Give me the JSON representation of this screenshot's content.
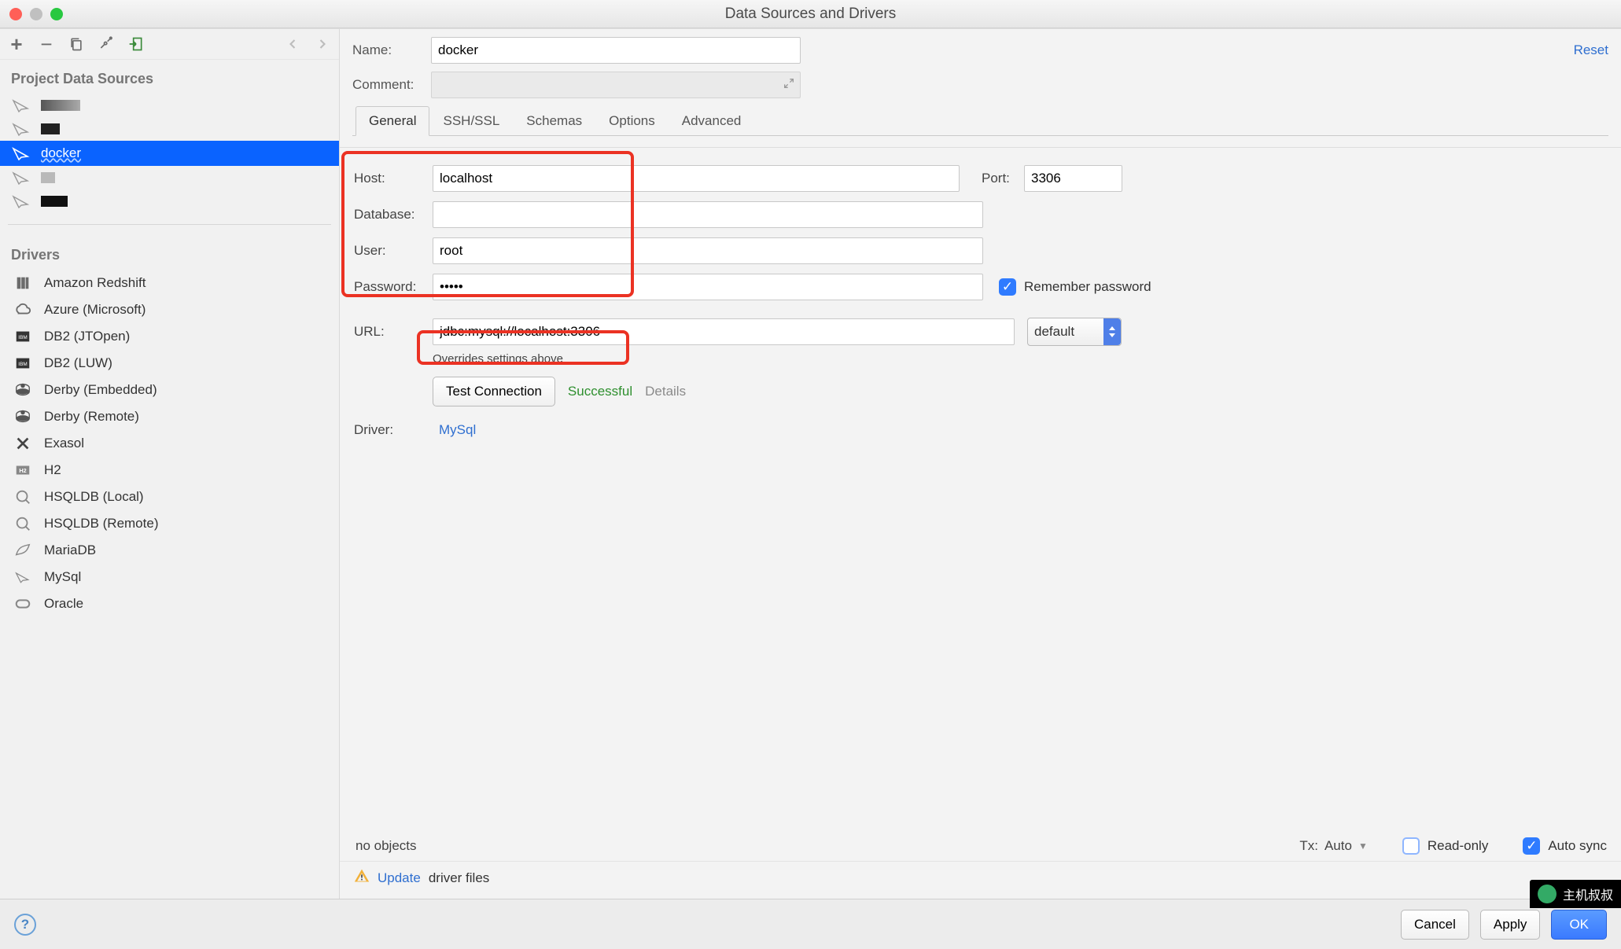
{
  "window": {
    "title": "Data Sources and Drivers"
  },
  "reset_label": "Reset",
  "toolbar": {
    "plus": "+",
    "minus": "−"
  },
  "sidebar": {
    "ds_title": "Project Data Sources",
    "items": [
      {
        "label": ""
      },
      {
        "label": ""
      },
      {
        "label": "docker",
        "selected": true
      },
      {
        "label": ""
      },
      {
        "label": ""
      }
    ],
    "drivers_title": "Drivers",
    "drivers": [
      "Amazon Redshift",
      "Azure (Microsoft)",
      "DB2 (JTOpen)",
      "DB2 (LUW)",
      "Derby (Embedded)",
      "Derby (Remote)",
      "Exasol",
      "H2",
      "HSQLDB (Local)",
      "HSQLDB (Remote)",
      "MariaDB",
      "MySql",
      "Oracle"
    ]
  },
  "form": {
    "name_label": "Name:",
    "name_value": "docker",
    "comment_label": "Comment:"
  },
  "tabs": [
    "General",
    "SSH/SSL",
    "Schemas",
    "Options",
    "Advanced"
  ],
  "general": {
    "host_label": "Host:",
    "host_value": "localhost",
    "port_label": "Port:",
    "port_value": "3306",
    "database_label": "Database:",
    "database_value": "",
    "user_label": "User:",
    "user_value": "root",
    "password_label": "Password:",
    "password_value": "•••••",
    "remember_label": "Remember password",
    "url_label": "URL:",
    "url_value": "jdbc:mysql://localhost:3306",
    "url_mode": "default",
    "url_hint": "Overrides settings above",
    "test_label": "Test Connection",
    "test_status": "Successful",
    "details_label": "Details",
    "driver_label": "Driver:",
    "driver_value": "MySql"
  },
  "bottom": {
    "no_objects": "no objects",
    "tx_label": "Tx:",
    "tx_value": "Auto",
    "readonly_label": "Read-only",
    "autosync_label": "Auto sync"
  },
  "update": {
    "link": "Update",
    "rest": "driver files"
  },
  "footer": {
    "cancel": "Cancel",
    "apply": "Apply",
    "ok": "OK",
    "help": "?"
  },
  "watermark": "主机叔叔"
}
